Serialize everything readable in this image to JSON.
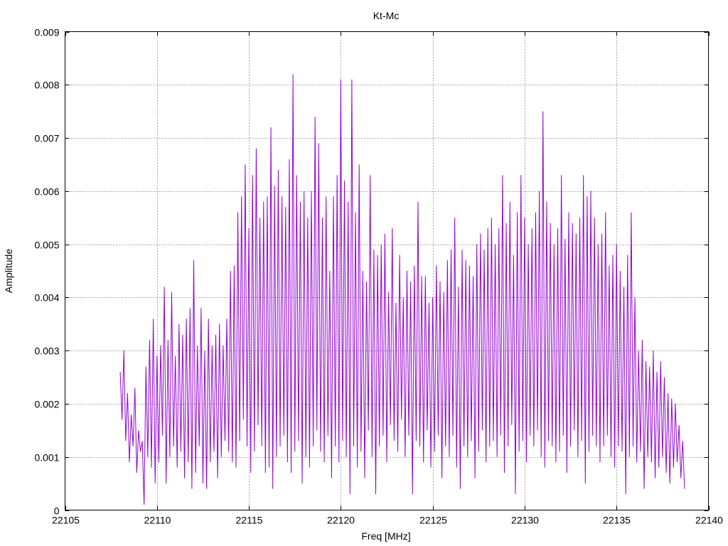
{
  "chart_data": {
    "type": "line",
    "title": "Kt-Mc",
    "xlabel": "Freq [MHz]",
    "ylabel": "Amplitude",
    "xlim": [
      22105,
      22140
    ],
    "ylim": [
      0,
      0.009
    ],
    "xticks": [
      "22105",
      "22110",
      "22115",
      "22120",
      "22125",
      "22130",
      "22135",
      "22140"
    ],
    "yticks": [
      "0",
      "0.001",
      "0.002",
      "0.003",
      "0.004",
      "0.005",
      "0.006",
      "0.007",
      "0.008",
      "0.009"
    ],
    "grid": true,
    "legend": "none",
    "series": [
      {
        "color": "#9400d3",
        "x_start": 22108.0,
        "x_step": 0.2,
        "peaks": [
          0.0026,
          0.003,
          0.0022,
          0.0018,
          0.0023,
          0.0015,
          0.0013,
          0.0027,
          0.0032,
          0.0036,
          0.0029,
          0.0031,
          0.0042,
          0.0032,
          0.0041,
          0.0029,
          0.0035,
          0.0033,
          0.0036,
          0.0038,
          0.0047,
          0.0031,
          0.0038,
          0.003,
          0.0036,
          0.0031,
          0.0033,
          0.0035,
          0.0031,
          0.0036,
          0.0045,
          0.0046,
          0.0056,
          0.0059,
          0.0065,
          0.0053,
          0.0063,
          0.0068,
          0.0055,
          0.0058,
          0.0059,
          0.0072,
          0.0061,
          0.0064,
          0.0059,
          0.0057,
          0.0066,
          0.0082,
          0.0063,
          0.0058,
          0.006,
          0.0055,
          0.006,
          0.0074,
          0.0069,
          0.0055,
          0.0059,
          0.0045,
          0.0059,
          0.0063,
          0.0081,
          0.0062,
          0.0058,
          0.0081,
          0.0056,
          0.0065,
          0.0045,
          0.0043,
          0.0063,
          0.0049,
          0.0048,
          0.005,
          0.0052,
          0.0041,
          0.0053,
          0.0039,
          0.0048,
          0.004,
          0.0045,
          0.0043,
          0.0046,
          0.0058,
          0.0044,
          0.0044,
          0.0039,
          0.004,
          0.0046,
          0.0043,
          0.0041,
          0.0047,
          0.0049,
          0.0055,
          0.0042,
          0.0049,
          0.0047,
          0.0046,
          0.0044,
          0.005,
          0.0052,
          0.0049,
          0.0053,
          0.0055,
          0.005,
          0.0053,
          0.0063,
          0.0054,
          0.0058,
          0.0048,
          0.0056,
          0.0063,
          0.0055,
          0.005,
          0.0053,
          0.0056,
          0.006,
          0.0075,
          0.0058,
          0.0054,
          0.005,
          0.0053,
          0.0063,
          0.0051,
          0.0056,
          0.0054,
          0.0052,
          0.0055,
          0.0063,
          0.0059,
          0.006,
          0.0055,
          0.005,
          0.0052,
          0.0056,
          0.0046,
          0.0048,
          0.005,
          0.0045,
          0.0042,
          0.0048,
          0.0056,
          0.004,
          0.003,
          0.0032,
          0.0028,
          0.0027,
          0.003,
          0.0026,
          0.0028,
          0.0025,
          0.0022,
          0.0021,
          0.002,
          0.0016,
          0.0013
        ],
        "troughs": [
          0.0017,
          0.0013,
          0.0009,
          0.0012,
          0.0007,
          0.0011,
          0.0001,
          0.001,
          0.0008,
          0.0005,
          0.0009,
          0.0014,
          0.0005,
          0.001,
          0.0012,
          0.0008,
          0.0011,
          0.0006,
          0.0009,
          0.0004,
          0.0007,
          0.0012,
          0.0005,
          0.0004,
          0.0009,
          0.0011,
          0.0006,
          0.001,
          0.0013,
          0.0011,
          0.0009,
          0.0008,
          0.0013,
          0.0017,
          0.0012,
          0.0007,
          0.0011,
          0.0016,
          0.0012,
          0.0007,
          0.0008,
          0.0004,
          0.001,
          0.0012,
          0.0014,
          0.0009,
          0.0007,
          0.0011,
          0.0013,
          0.0005,
          0.001,
          0.0008,
          0.0012,
          0.0015,
          0.0011,
          0.0009,
          0.0014,
          0.0006,
          0.0012,
          0.0009,
          0.0013,
          0.001,
          0.0003,
          0.0012,
          0.0008,
          0.0011,
          0.0006,
          0.0015,
          0.001,
          0.0003,
          0.0012,
          0.0014,
          0.0009,
          0.0016,
          0.0013,
          0.0011,
          0.0017,
          0.001,
          0.0014,
          0.0003,
          0.0013,
          0.0012,
          0.0009,
          0.0015,
          0.0008,
          0.0011,
          0.0014,
          0.0006,
          0.0012,
          0.001,
          0.0014,
          0.0008,
          0.0004,
          0.0012,
          0.001,
          0.0013,
          0.0006,
          0.0011,
          0.0015,
          0.0009,
          0.0012,
          0.0013,
          0.001,
          0.0014,
          0.0007,
          0.0012,
          0.0016,
          0.0003,
          0.0011,
          0.0013,
          0.0009,
          0.0014,
          0.0012,
          0.0015,
          0.001,
          0.0008,
          0.0013,
          0.0012,
          0.0009,
          0.0011,
          0.0014,
          0.0007,
          0.0012,
          0.0015,
          0.001,
          0.0013,
          0.0005,
          0.0011,
          0.0014,
          0.0012,
          0.0009,
          0.0012,
          0.0014,
          0.001,
          0.0008,
          0.0012,
          0.0011,
          0.0003,
          0.001,
          0.0012,
          0.0009,
          0.0011,
          0.0004,
          0.001,
          0.0009,
          0.0006,
          0.0008,
          0.001,
          0.0007,
          0.0005,
          0.0008,
          0.0009,
          0.0006,
          0.0004
        ]
      }
    ]
  }
}
